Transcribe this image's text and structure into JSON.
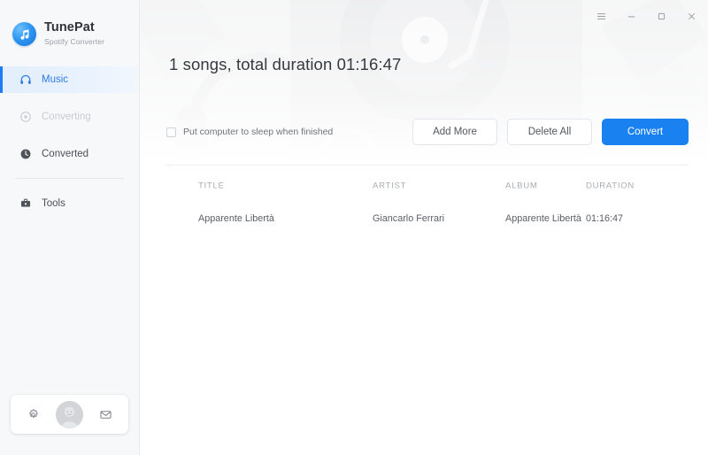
{
  "app": {
    "brand_title": "TunePat",
    "brand_subtitle": "Spotify Converter",
    "accent_color": "#1a82f0",
    "sidebar_bg": "#f7f8fa"
  },
  "window_controls": [
    {
      "name": "menu-icon",
      "label": "Menu"
    },
    {
      "name": "minimize-icon",
      "label": "Minimize"
    },
    {
      "name": "maximize-icon",
      "label": "Maximize"
    },
    {
      "name": "close-icon",
      "label": "Close"
    }
  ],
  "sidebar": {
    "items": [
      {
        "label": "Music",
        "icon": "headphones-icon",
        "state": "active"
      },
      {
        "label": "Converting",
        "icon": "converting-icon",
        "state": "disabled"
      },
      {
        "label": "Converted",
        "icon": "clock-icon",
        "state": "normal"
      },
      {
        "label": "Tools",
        "icon": "toolbox-icon",
        "state": "normal"
      }
    ],
    "dock": {
      "settings_label": "Settings",
      "avatar_label": "Account",
      "feedback_label": "Feedback"
    }
  },
  "main": {
    "summary": "1 songs, total duration 01:16:47",
    "sleep_checkbox_label": "Put computer to sleep when finished",
    "sleep_checkbox_checked": false,
    "buttons": {
      "add_more": "Add More",
      "delete_all": "Delete All",
      "convert": "Convert"
    },
    "table": {
      "columns": [
        "TITLE",
        "ARTIST",
        "ALBUM",
        "DURATION"
      ],
      "rows": [
        {
          "title": "Apparente Libertà",
          "artist": "Giancarlo Ferrari",
          "album": "Apparente Libertà",
          "duration": "01:16:47"
        }
      ]
    }
  }
}
